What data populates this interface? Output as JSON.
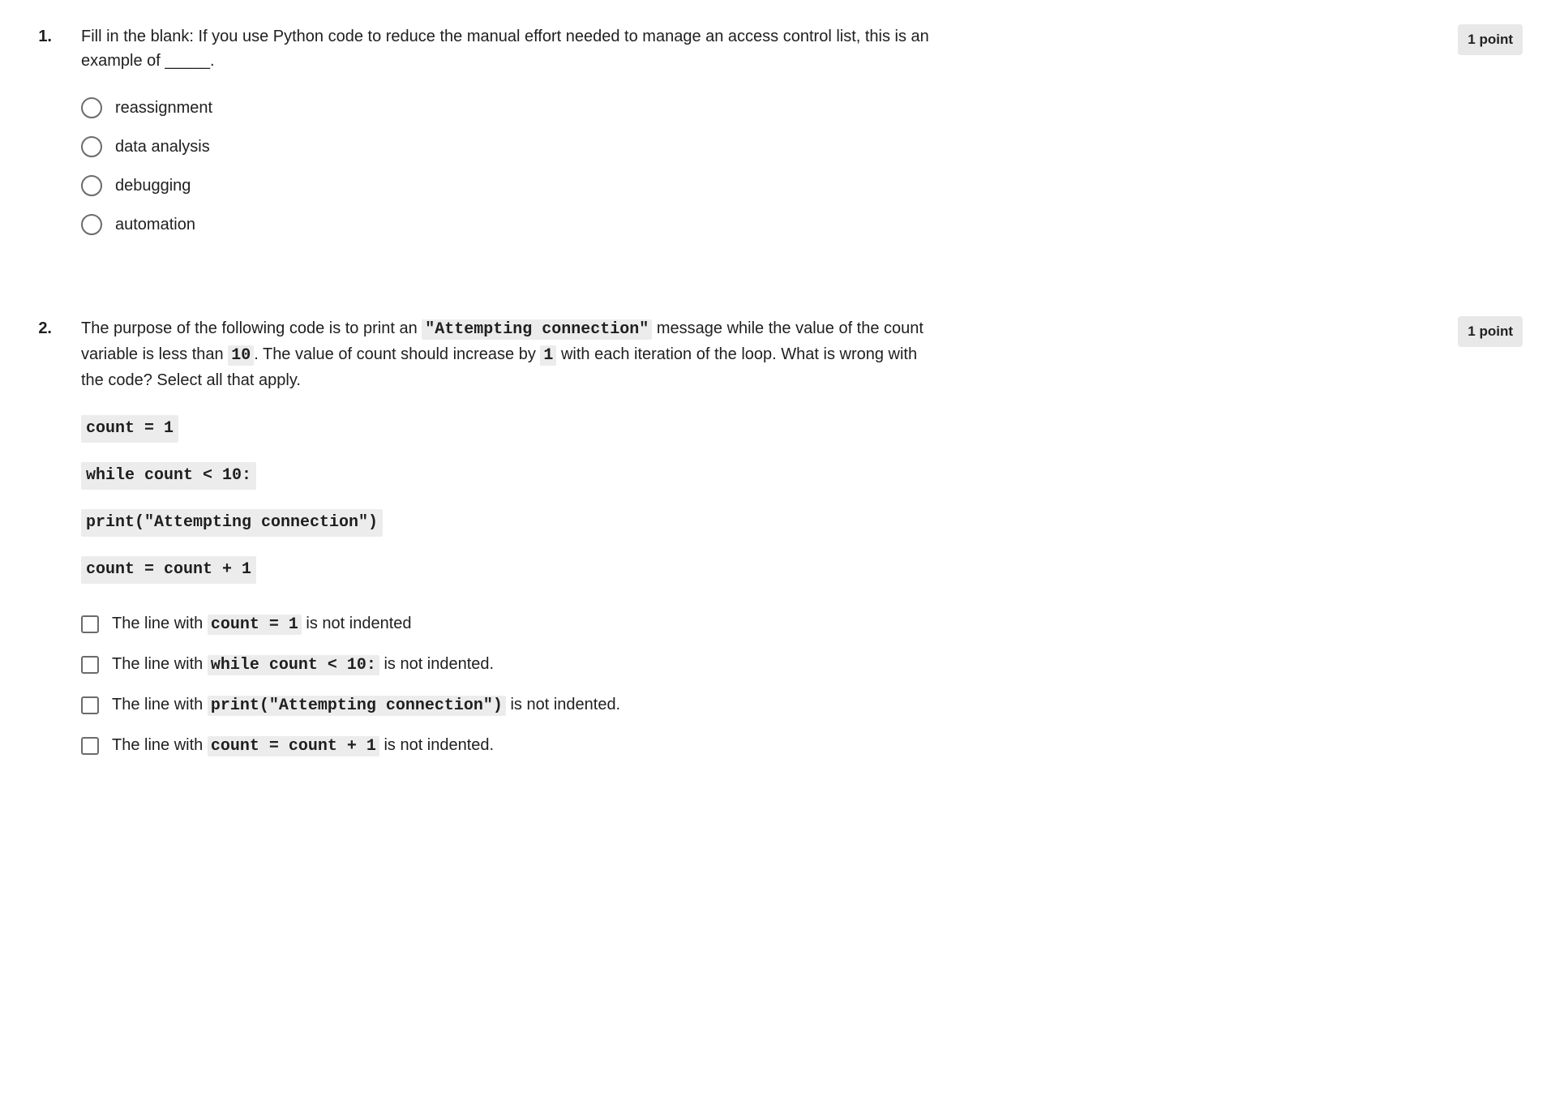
{
  "questions": [
    {
      "number": "1.",
      "points": "1 point",
      "text": "Fill in the blank: If you use Python code to reduce the manual effort needed to manage an access control list, this is an example of _____.",
      "type": "radio",
      "options": [
        {
          "label": "reassignment"
        },
        {
          "label": "data analysis"
        },
        {
          "label": "debugging"
        },
        {
          "label": "automation"
        }
      ]
    },
    {
      "number": "2.",
      "points": "1 point",
      "text_parts": {
        "p1": "The purpose of the following code is to print an ",
        "c1": "\"Attempting connection\"",
        "p2": " message while the value of the count variable is less than ",
        "c2": "10",
        "p3": ". The value of count should increase by ",
        "c3": "1",
        "p4": " with each iteration of the loop. What is wrong with the code? Select all that apply."
      },
      "code_lines": [
        "count = 1",
        "while count < 10:",
        "print(\"Attempting connection\")",
        "count = count + 1"
      ],
      "type": "checkbox",
      "options_mixed": [
        {
          "pre": "The line with ",
          "code": "count = 1",
          "post": " is not indented"
        },
        {
          "pre": "The line with ",
          "code": "while count < 10:",
          "post": " is not indented."
        },
        {
          "pre": "The line with ",
          "code": "print(\"Attempting connection\")",
          "post": " is not indented."
        },
        {
          "pre": "The line with ",
          "code": "count = count + 1",
          "post": " is not indented."
        }
      ]
    }
  ]
}
